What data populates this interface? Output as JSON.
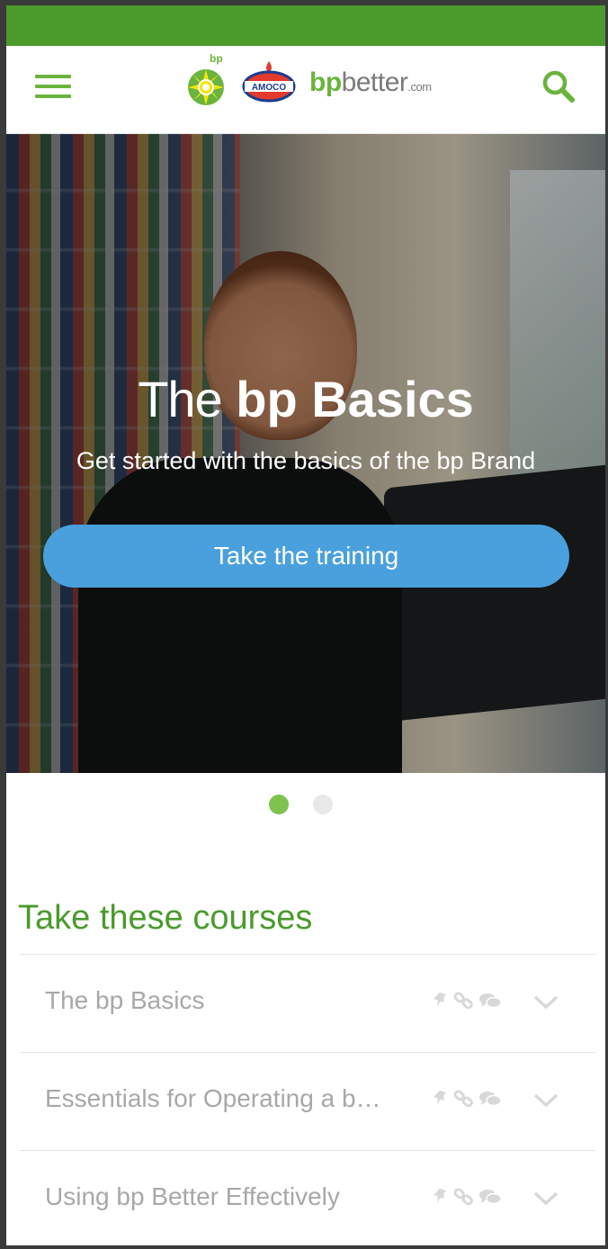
{
  "colors": {
    "topbar": "#4a9b2c",
    "accent_green": "#6ab43e",
    "cta_blue": "#4aa0dc",
    "text_gray": "#a8a8a8"
  },
  "header": {
    "menu_icon": "hamburger-menu-icon",
    "bp_logo_text": "bp",
    "amoco_logo_text": "AMOCO",
    "site_name_bp": "bp",
    "site_name_rest": "better",
    "site_name_tld": ".com",
    "search_icon": "search-icon"
  },
  "hero": {
    "title_light": "The",
    "title_bold": "bp Basics",
    "subtitle": "Get started with the basics of the bp Brand",
    "cta_label": "Take the training"
  },
  "carousel": {
    "slides": 2,
    "active_index": 0
  },
  "courses": {
    "section_title": "Take these courses",
    "items": [
      {
        "label": "The bp Basics"
      },
      {
        "label": "Essentials for Operating a b…"
      },
      {
        "label": "Using bp Better Effectively"
      }
    ]
  }
}
